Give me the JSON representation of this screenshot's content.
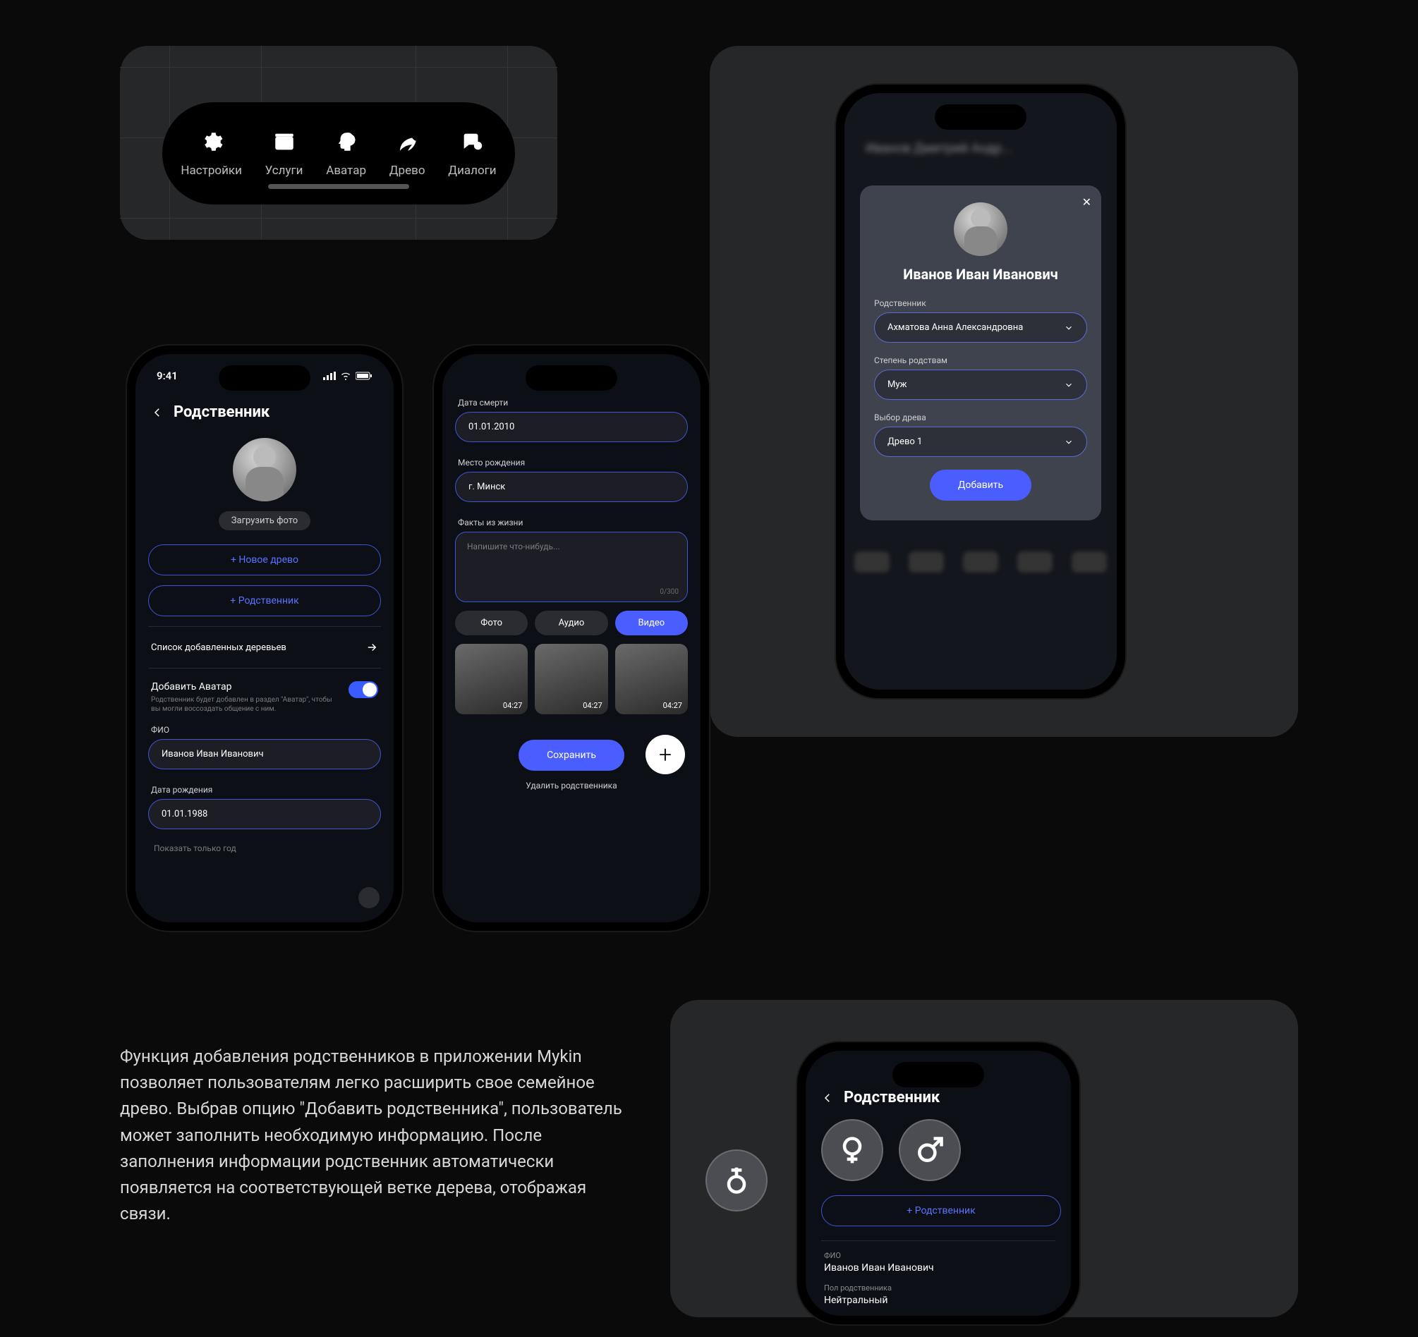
{
  "toolbar": {
    "items": [
      {
        "label": "Настройки",
        "icon": "gear-icon"
      },
      {
        "label": "Услуги",
        "icon": "box-icon"
      },
      {
        "label": "Аватар",
        "icon": "head-icon"
      },
      {
        "label": "Древо",
        "icon": "leaf-icon"
      },
      {
        "label": "Диалоги",
        "icon": "chat-icon"
      }
    ]
  },
  "phone1": {
    "time": "9:41",
    "header": "Родственник",
    "upload_label": "Загрузить фото",
    "btn_new_tree": "+  Новое древо",
    "btn_relative": "+  Родственник",
    "list_trees": "Список добавленных деревьев",
    "add_avatar_title": "Добавить Аватар",
    "add_avatar_sub": "Родственник будет добавлен в раздел \"Аватар\", чтобы вы могли воссоздать общение с ним.",
    "fio_label": "ФИО",
    "fio_value": "Иванов Иван Иванович",
    "dob_label": "Дата рождения",
    "dob_value": "01.01.1988",
    "show_year": "Показать только год"
  },
  "phone2": {
    "dod_label": "Дата смерти",
    "dod_value": "01.01.2010",
    "birthplace_label": "Место рождения",
    "birthplace_value": "г. Минск",
    "facts_label": "Факты из жизни",
    "facts_placeholder": "Напишите что-нибудь...",
    "counter": "0/300",
    "tab_photo": "Фото",
    "tab_audio": "Аудио",
    "tab_video": "Видео",
    "thumb_duration": "04:27",
    "save_label": "Сохранить",
    "delete_label": "Удалить родственника"
  },
  "phone3": {
    "blurred_name": "Иванов Дмитрий Андр...",
    "modal_name": "Иванов Иван Иванович",
    "relative_label": "Родственник",
    "relative_value": "Ахматова Анна Александровна",
    "degree_label": "Степень родствам",
    "degree_value": "Муж",
    "tree_label": "Выбор древа",
    "tree_value": "Древо 1",
    "add_label": "Добавить"
  },
  "phone4": {
    "header": "Родственник",
    "btn_relative": "+    Родственник",
    "fio_label": "ФИО",
    "fio_value": "Иванов Иван Иванович",
    "gender_label": "Пол родственника",
    "gender_value": "Нейтральный"
  },
  "description": "Функция добавления родственников в приложении Mykin позволяет пользователям легко расширить свое семейное древо. Выбрав опцию \"Добавить родственника\", пользователь может заполнить необходимую информацию. После заполнения информации родственник автоматически появляется на соответствующей ветке дерева, отображая связи."
}
